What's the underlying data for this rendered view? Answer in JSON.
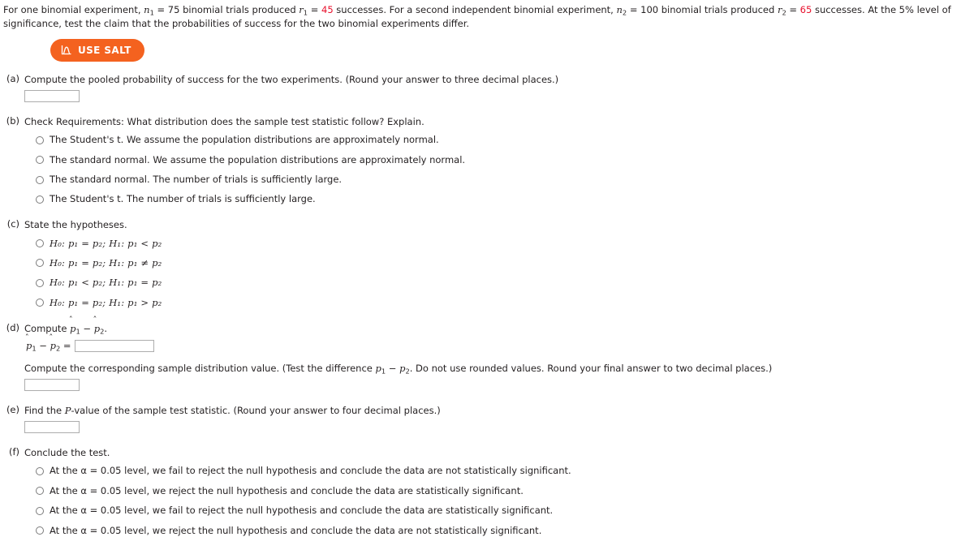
{
  "problem": {
    "text_part1": "For one binomial experiment, ",
    "n1_sym": "n",
    "n1_sub": "1",
    "text_part2": " = 75 binomial trials produced ",
    "r1_sym": "r",
    "r1_sub": "1",
    "text_part3": " = ",
    "r1_value": "45",
    "text_part4": " successes. For a second independent binomial experiment, ",
    "n2_sym": "n",
    "n2_sub": "2",
    "text_part5": " = 100 binomial trials produced ",
    "r2_sym": "r",
    "r2_sub": "2",
    "text_part6": " = ",
    "r2_value": "65",
    "text_part7": " successes. At the 5% level of significance, test the claim that the probabilities of success for the two binomial experiments differ.",
    "highlight_color": "#e8112d"
  },
  "salt_button": {
    "label": "USE SALT",
    "icon": "distribution-curve-icon",
    "color": "#f4621f"
  },
  "parts": {
    "a": {
      "label": "(a)",
      "prompt": "Compute the pooled probability of success for the two experiments. (Round your answer to three decimal places.)",
      "input_value": "",
      "input_placeholder": ""
    },
    "b": {
      "label": "(b)",
      "prompt": "Check Requirements: What distribution does the sample test statistic follow? Explain.",
      "options": [
        "The Student's t. We assume the population distributions are approximately normal.",
        "The standard normal. We assume the population distributions are approximately normal.",
        "The standard normal. The number of trials is sufficiently large.",
        "The Student's t. The number of trials is sufficiently large."
      ]
    },
    "c": {
      "label": "(c)",
      "prompt": "State the hypotheses.",
      "options": [
        "H₀: p₁ = p₂; H₁: p₁ < p₂",
        "H₀: p₁ = p₂; H₁: p₁ ≠ p₂",
        "H₀: p₁ < p₂; H₁: p₁ = p₂",
        "H₀: p₁ = p₂; H₁: p₁ > p₂"
      ]
    },
    "d": {
      "label": "(d)",
      "prompt_prefix": "Compute ",
      "prompt_expr": "p̂1 − p̂2",
      "prompt_suffix": ".",
      "equation_label": "p̂1 − p̂2 =",
      "input_value": "",
      "subprompt_part1": "Compute the corresponding sample distribution value. (Test the difference ",
      "subprompt_expr": "p1 − p2",
      "subprompt_part2": ". Do not use rounded values. Round your final answer to two decimal places.)",
      "sub_input_value": ""
    },
    "e": {
      "label": "(e)",
      "prompt_part1": "Find the ",
      "prompt_pvalue": "P",
      "prompt_part2": "-value of the sample test statistic. (Round your answer to four decimal places.)",
      "input_value": ""
    },
    "f": {
      "label": "(f)",
      "prompt": "Conclude the test.",
      "options": [
        "At the α = 0.05 level, we fail to reject the null hypothesis and conclude the data are not statistically significant.",
        "At the α = 0.05 level, we reject the null hypothesis and conclude the data are statistically significant.",
        "At the α = 0.05 level, we fail to reject the null hypothesis and conclude the data are statistically significant.",
        "At the α = 0.05 level, we reject the null hypothesis and conclude the data are not statistically significant."
      ]
    }
  }
}
